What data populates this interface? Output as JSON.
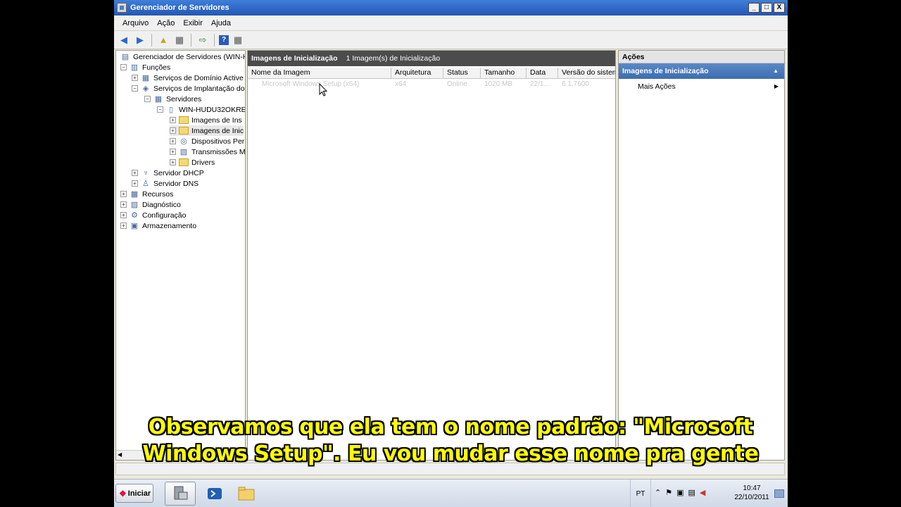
{
  "window": {
    "title": "Gerenciador de Servidores",
    "btn_min": "_",
    "btn_max": "□",
    "btn_close": "X"
  },
  "menu": [
    "Arquivo",
    "Ação",
    "Exibir",
    "Ajuda"
  ],
  "tree": {
    "items": [
      {
        "label": "Gerenciador de Servidores (WIN-HU",
        "icon": "server-manager-icon",
        "exp": ""
      },
      {
        "label": "Funções",
        "icon": "roles-icon",
        "exp": "−"
      },
      {
        "label": "Serviços de Domínio Active",
        "icon": "ad-icon",
        "exp": "+"
      },
      {
        "label": "Serviços de Implantação do",
        "icon": "wds-icon",
        "exp": "−"
      },
      {
        "label": "Servidores",
        "icon": "servers-icon",
        "exp": "−"
      },
      {
        "label": "WIN-HUDU32OKRE",
        "icon": "server-icon",
        "exp": "−"
      },
      {
        "label": "Imagens de Ins",
        "icon": "folder-icon",
        "exp": "+"
      },
      {
        "label": "Imagens de Inic",
        "icon": "folder-icon",
        "exp": "+"
      },
      {
        "label": "Dispositivos Per",
        "icon": "devices-icon",
        "exp": "+"
      },
      {
        "label": "Transmissões M",
        "icon": "multicast-icon",
        "exp": "+"
      },
      {
        "label": "Drivers",
        "icon": "folder-icon",
        "exp": "+"
      },
      {
        "label": "Servidor DHCP",
        "icon": "dhcp-icon",
        "exp": "+"
      },
      {
        "label": "Servidor DNS",
        "icon": "dns-icon",
        "exp": "+"
      },
      {
        "label": "Recursos",
        "icon": "features-icon",
        "exp": "+"
      },
      {
        "label": "Diagnóstico",
        "icon": "diagnostics-icon",
        "exp": "+"
      },
      {
        "label": "Configuração",
        "icon": "config-icon",
        "exp": "+"
      },
      {
        "label": "Armazenamento",
        "icon": "storage-icon",
        "exp": "+"
      }
    ]
  },
  "middle": {
    "title": "Imagens de Inicialização",
    "count": "1 Imagem(s) de Inicialização",
    "columns": [
      "Nome da Imagem",
      "Arquitetura",
      "Status",
      "Tamanho",
      "Data",
      "Versão do sistem"
    ],
    "rows": [
      [
        "Microsoft Windows Setup (x64)",
        "x64",
        "Online",
        "1020 MB",
        "22/1...",
        "6.1.7600"
      ]
    ]
  },
  "actions": {
    "title": "Ações",
    "section": "Imagens de Inicialização",
    "more": "Mais Ações"
  },
  "taskbar": {
    "start": "Iniciar",
    "lang": "PT",
    "time": "10:47",
    "date": "22/10/2011"
  },
  "subtitle": {
    "line1": "Observamos que ela tem o nome padrão: \"Microsoft",
    "line2": "Windows Setup\". Eu vou mudar esse nome pra gente"
  },
  "colors": {
    "title_bar": "#2457b5",
    "subtitle": "#ffff00",
    "action_header": "#3d6db0"
  }
}
